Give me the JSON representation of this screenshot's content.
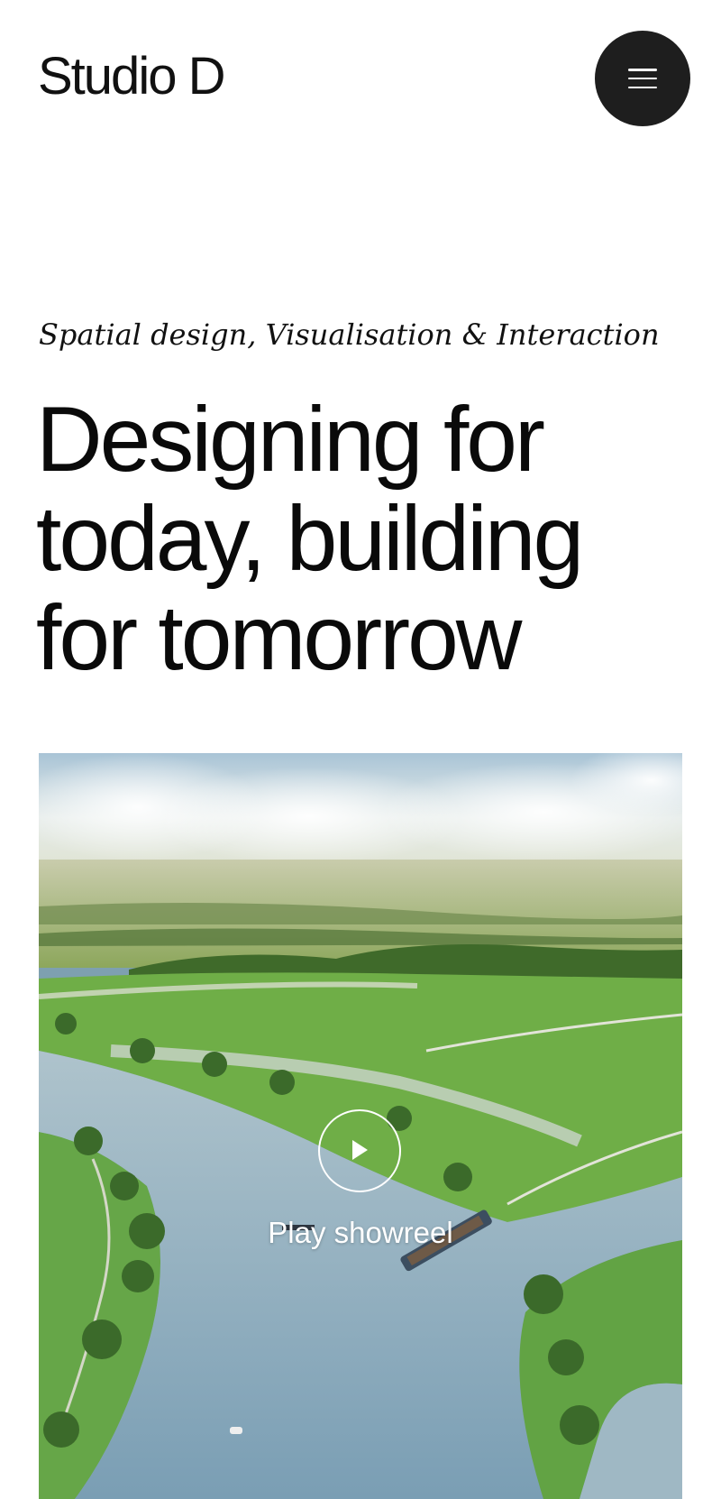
{
  "brand": {
    "name": "Studio D"
  },
  "header": {
    "menu_icon": "hamburger-menu-icon"
  },
  "hero": {
    "tagline": "Spatial design, Visualisation & Interaction",
    "headline_lines": [
      "Designing for",
      "today, building",
      "for tomorrow"
    ],
    "play_icon": "play-icon",
    "play_label": "Play showreel"
  },
  "colors": {
    "background": "#ffffff",
    "text": "#111111",
    "menu_button": "#1e1e1e",
    "water": "#8fb0c0",
    "grass": "#6aa84a",
    "sky": "#cfe0ea"
  }
}
